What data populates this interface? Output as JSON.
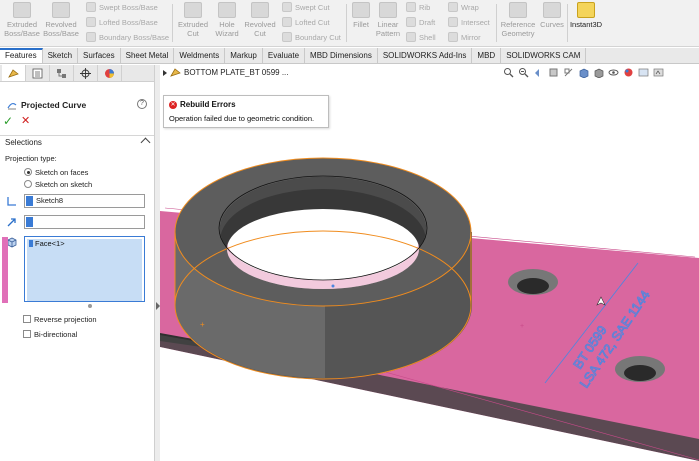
{
  "ribbon": {
    "extruded_boss": "Extruded\nBoss/Base",
    "revolved_boss": "Revolved\nBoss/Base",
    "swept_boss": "Swept Boss/Base",
    "lofted_boss": "Lofted Boss/Base",
    "boundary_boss": "Boundary Boss/Base",
    "extruded_cut": "Extruded\nCut",
    "hole_wizard": "Hole\nWizard",
    "revolved_cut": "Revolved\nCut",
    "swept_cut": "Swept Cut",
    "lofted_cut": "Lofted Cut",
    "boundary_cut": "Boundary Cut",
    "fillet": "Fillet",
    "linear_pattern": "Linear\nPattern",
    "rib": "Rib",
    "draft": "Draft",
    "shell": "Shell",
    "wrap": "Wrap",
    "intersect": "Intersect",
    "mirror": "Mirror",
    "reference_geometry": "Reference\nGeometry",
    "curves": "Curves",
    "instant3d": "Instant3D"
  },
  "tabs": [
    "Features",
    "Sketch",
    "Surfaces",
    "Sheet Metal",
    "Weldments",
    "Markup",
    "Evaluate",
    "MBD Dimensions",
    "SOLIDWORKS Add-Ins",
    "MBD",
    "SOLIDWORKS CAM"
  ],
  "active_tab": "Features",
  "property_manager": {
    "title": "Projected Curve",
    "help": "?",
    "ok": "✓",
    "cancel": "✕",
    "section": "Selections",
    "projection_type_label": "Projection type:",
    "radio_faces": "Sketch on faces",
    "radio_sketch": "Sketch on sketch",
    "sketch_value": "Sketch8",
    "direction_value": "",
    "face_item": "Face<1>",
    "reverse_projection": "Reverse projection",
    "bi_directional": "Bi-directional"
  },
  "viewport": {
    "part_name": "BOTTOM PLATE_BT 0599 ..."
  },
  "error": {
    "title": "Rebuild Errors",
    "message": "Operation failed due to geometric condition."
  },
  "colors": {
    "plate_pink": "#d9679f",
    "ring_gray": "#6b6b6b",
    "selection_orange": "#f08c1e",
    "accent_blue": "#3a7bd5"
  },
  "model_text": {
    "line1": "BT 0599",
    "line2": "LSA 472, SAE 1144"
  }
}
